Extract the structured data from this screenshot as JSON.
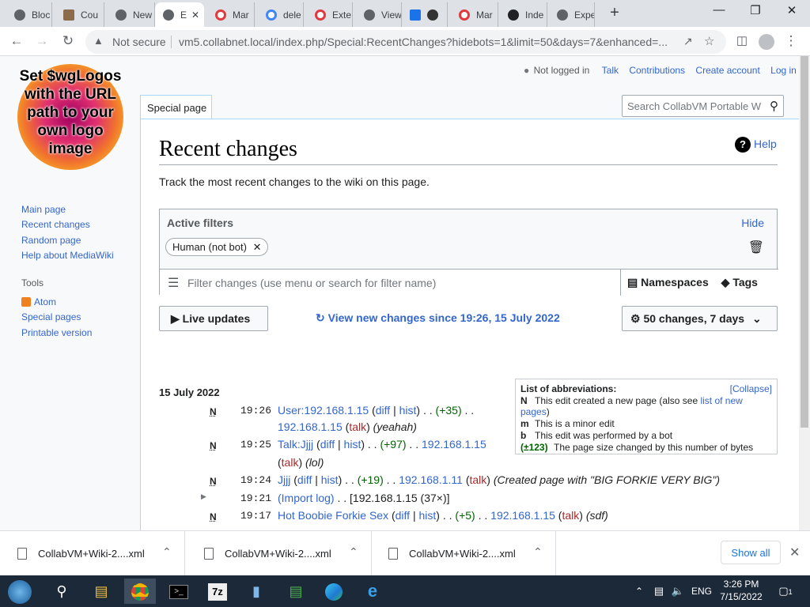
{
  "browser": {
    "tabs": [
      {
        "title": "Bloc",
        "icon": "globe-icon"
      },
      {
        "title": "Cou",
        "icon": "avatar-icon"
      },
      {
        "title": "New",
        "icon": "globe-icon"
      },
      {
        "title": "E",
        "icon": "globe-icon",
        "active": true
      },
      {
        "title": "Mar",
        "icon": "opera-icon"
      },
      {
        "title": "dele",
        "icon": "google-icon"
      },
      {
        "title": "Exte",
        "icon": "opera-icon"
      },
      {
        "title": "View",
        "icon": "globe-icon"
      },
      {
        "title": "",
        "icon": "app-icon"
      },
      {
        "title": "Mar",
        "icon": "opera-icon"
      },
      {
        "title": "Inde",
        "icon": "wikipedia-icon"
      },
      {
        "title": "Expe",
        "icon": "globe-icon"
      }
    ],
    "not_secure_label": "Not secure",
    "url": "vm5.collabnet.local/index.php/Special:RecentChanges?hidebots=1&limit=50&days=7&enhanced=..."
  },
  "wiki": {
    "logo_text": "Set $wgLogos with the URL path to your own logo image",
    "user_menu": {
      "not_logged_in": "Not logged in",
      "talk": "Talk",
      "contributions": "Contributions",
      "create_account": "Create account",
      "log_in": "Log in"
    },
    "special_page_tab": "Special page",
    "search_placeholder": "Search CollabVM Portable W",
    "navigation": [
      "Main page",
      "Recent changes",
      "Random page",
      "Help about MediaWiki"
    ],
    "tools_heading": "Tools",
    "tools": [
      "Atom",
      "Special pages",
      "Printable version"
    ],
    "title": "Recent changes",
    "help": "Help",
    "description": "Track the most recent changes to the wiki on this page.",
    "filters": {
      "heading": "Active filters",
      "hide": "Hide",
      "chip": "Human (not bot)",
      "filter_placeholder": "Filter changes (use menu or search for filter name)",
      "namespaces": "Namespaces",
      "tags": "Tags"
    },
    "live_updates": "Live updates",
    "view_new": "View new changes since 19:26, 15 July 2022",
    "changes_dropdown": "50 changes, 7 days",
    "legend": {
      "heading": "List of abbreviations:",
      "collapse": "[Collapse]",
      "items": [
        {
          "key": "N",
          "text": "This edit created a new page (also see ",
          "link": "list of new pages",
          "tail": ")"
        },
        {
          "key": "m",
          "text": "This is a minor edit",
          "link": "",
          "tail": ""
        },
        {
          "key": "b",
          "text": "This edit was performed by a bot",
          "link": "",
          "tail": ""
        },
        {
          "key": "(±123)",
          "text": "The page size changed by this number of bytes",
          "link": "",
          "tail": ""
        }
      ]
    },
    "day_label": "15 July 2022",
    "changes": [
      {
        "flag": "N",
        "time": "19:26",
        "page": "User:192.168.1.15",
        "diff": "diff",
        "hist": "hist",
        "size": "(+35)",
        "user": "192.168.1.15",
        "talk": "talk",
        "comment": "(yeahah)"
      },
      {
        "flag": "N",
        "time": "19:25",
        "page": "Talk:Jjjj",
        "diff": "diff",
        "hist": "hist",
        "size": "(+97)",
        "user": "192.168.1.15",
        "talk": "talk",
        "comment": "(lol)"
      },
      {
        "flag": "N",
        "time": "19:24",
        "page": "Jjjj",
        "diff": "diff",
        "hist": "hist",
        "size": "(+19)",
        "user": "192.168.1.11",
        "talk": "talk",
        "comment": "(Created page with \"BIG FORKIE VERY BIG\")"
      },
      {
        "flag": "",
        "time": "19:21",
        "page": "(Import log)",
        "diff": "",
        "hist": "",
        "size": "",
        "user": "[192.168.1.15 (37×)]",
        "talk": "",
        "comment": ""
      },
      {
        "flag": "N",
        "time": "19:17",
        "page": "Hot Boobie Forkie Sex",
        "diff": "diff",
        "hist": "hist",
        "size": "(+5)",
        "user": "192.168.1.15",
        "talk": "talk",
        "comment": "(sdf)"
      }
    ]
  },
  "downloads": [
    {
      "name": "CollabVM+Wiki-2....xml"
    },
    {
      "name": "CollabVM+Wiki-2....xml"
    },
    {
      "name": "CollabVM+Wiki-2....xml"
    }
  ],
  "show_all": "Show all",
  "taskbar": {
    "lang": "ENG",
    "time": "3:26 PM",
    "date": "7/15/2022",
    "notifications": "1"
  }
}
